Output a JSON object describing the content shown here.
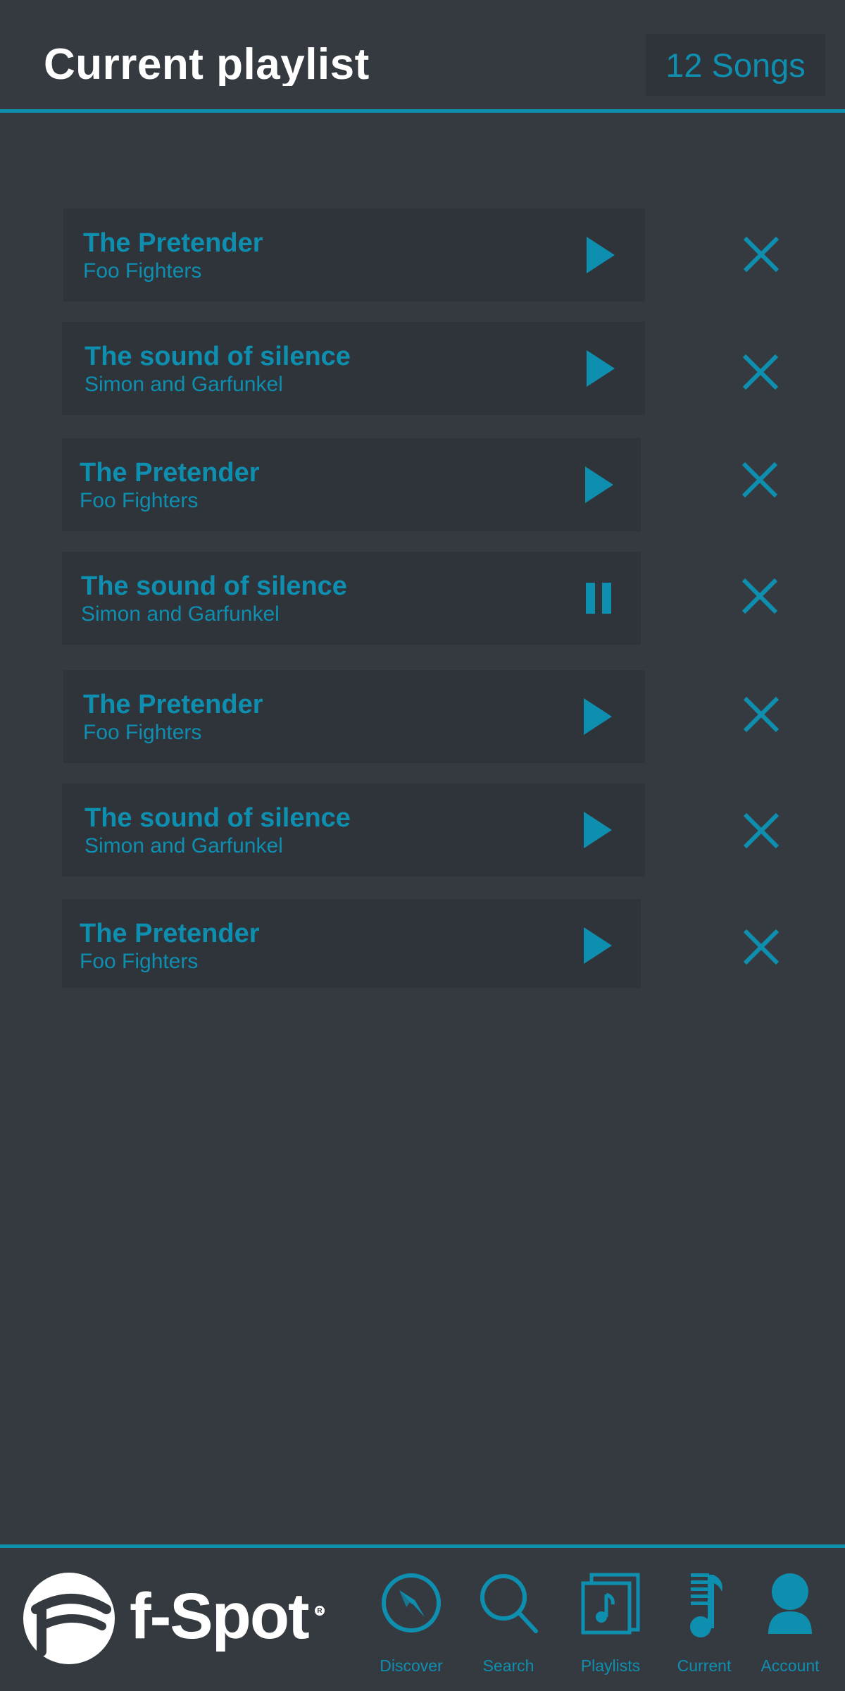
{
  "header": {
    "title": "Current playlist",
    "song_count": "12 Songs"
  },
  "playlist": [
    {
      "title": "The Pretender",
      "artist": "Foo Fighters",
      "state": "play"
    },
    {
      "title": "The sound of silence",
      "artist": "Simon and Garfunkel",
      "state": "play"
    },
    {
      "title": "The Pretender",
      "artist": "Foo Fighters",
      "state": "play"
    },
    {
      "title": "The sound of silence",
      "artist": "Simon and Garfunkel",
      "state": "pause"
    },
    {
      "title": "The Pretender",
      "artist": "Foo Fighters",
      "state": "play"
    },
    {
      "title": "The sound of silence",
      "artist": "Simon and Garfunkel",
      "state": "play"
    },
    {
      "title": "The Pretender",
      "artist": "Foo Fighters",
      "state": "play"
    }
  ],
  "footer": {
    "brand": "f-Spot",
    "nav": [
      {
        "label": "Discover",
        "icon": "compass-icon"
      },
      {
        "label": "Search",
        "icon": "search-icon"
      },
      {
        "label": "Playlists",
        "icon": "playlists-icon"
      },
      {
        "label": "Current",
        "icon": "current-icon"
      },
      {
        "label": "Account",
        "icon": "account-icon"
      }
    ]
  },
  "colors": {
    "background": "#353a41",
    "row_background": "#2f333a",
    "accent": "#0f8fb0",
    "text_light": "#ffffff"
  }
}
